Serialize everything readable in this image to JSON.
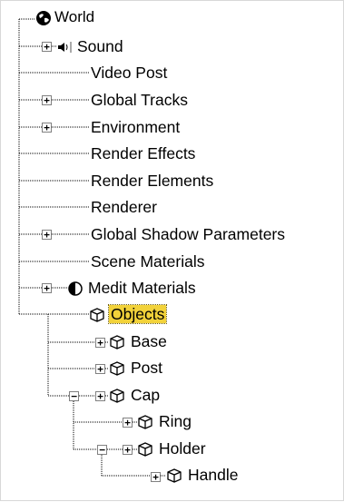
{
  "tree": {
    "items": [
      {
        "label": "World",
        "icon": "globe-icon"
      },
      {
        "label": "Sound",
        "icon": "speaker-icon",
        "expand": "plus"
      },
      {
        "label": "Video Post"
      },
      {
        "label": "Global Tracks",
        "expand": "plus"
      },
      {
        "label": "Environment",
        "expand": "plus"
      },
      {
        "label": "Render Effects"
      },
      {
        "label": "Render Elements"
      },
      {
        "label": "Renderer"
      },
      {
        "label": "Global Shadow Parameters",
        "expand": "plus"
      },
      {
        "label": "Scene Materials"
      },
      {
        "label": "Medit Materials",
        "icon": "material-sphere-icon",
        "expand": "plus"
      },
      {
        "label": "Objects",
        "icon": "object-cube-icon",
        "selected": true
      },
      {
        "label": "Base",
        "icon": "object-cube-icon",
        "expand": "plus"
      },
      {
        "label": "Post",
        "icon": "object-cube-icon",
        "expand": "plus"
      },
      {
        "label": "Cap",
        "icon": "object-cube-icon",
        "expand": "plus",
        "collapse": "minus"
      },
      {
        "label": "Ring",
        "icon": "object-cube-icon",
        "expand": "plus"
      },
      {
        "label": "Holder",
        "icon": "object-cube-icon",
        "expand": "plus",
        "collapse": "minus"
      },
      {
        "label": "Handle",
        "icon": "object-cube-icon",
        "expand": "plus"
      }
    ],
    "selection_color": "#f2d23a",
    "line_color": "#000000"
  }
}
